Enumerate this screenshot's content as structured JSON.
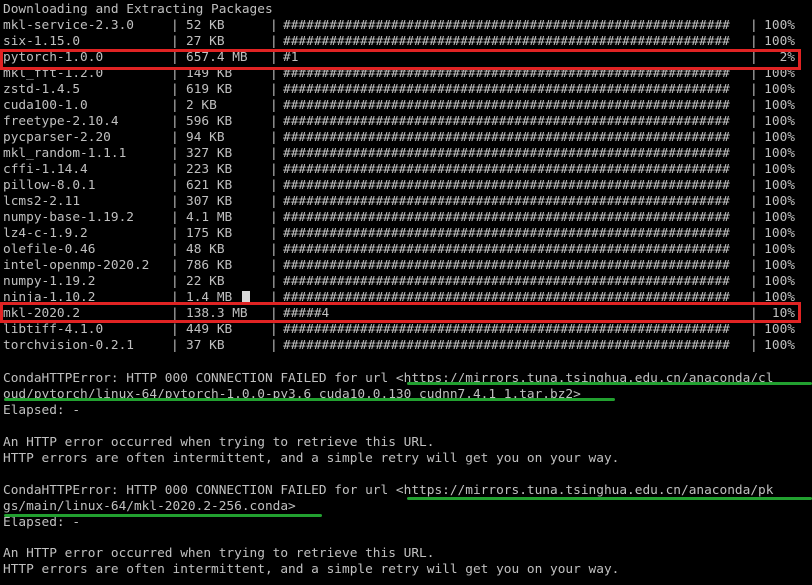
{
  "terminal": {
    "header": "Downloading and Extracting Packages",
    "packages": [
      {
        "name": "mkl-service-2.3.0",
        "size": "52 KB",
        "bar": "##########################################################",
        "percent": "100%"
      },
      {
        "name": "six-1.15.0",
        "size": "27 KB",
        "bar": "##########################################################",
        "percent": "100%"
      },
      {
        "name": "pytorch-1.0.0",
        "size": "657.4 MB",
        "bar": "#1",
        "percent": "2%"
      },
      {
        "name": "mkl_fft-1.2.0",
        "size": "149 KB",
        "bar": "##########################################################",
        "percent": "100%"
      },
      {
        "name": "zstd-1.4.5",
        "size": "619 KB",
        "bar": "##########################################################",
        "percent": "100%"
      },
      {
        "name": "cuda100-1.0",
        "size": "2 KB",
        "bar": "##########################################################",
        "percent": "100%"
      },
      {
        "name": "freetype-2.10.4",
        "size": "596 KB",
        "bar": "##########################################################",
        "percent": "100%"
      },
      {
        "name": "pycparser-2.20",
        "size": "94 KB",
        "bar": "##########################################################",
        "percent": "100%"
      },
      {
        "name": "mkl_random-1.1.1",
        "size": "327 KB",
        "bar": "##########################################################",
        "percent": "100%"
      },
      {
        "name": "cffi-1.14.4",
        "size": "223 KB",
        "bar": "##########################################################",
        "percent": "100%"
      },
      {
        "name": "pillow-8.0.1",
        "size": "621 KB",
        "bar": "##########################################################",
        "percent": "100%"
      },
      {
        "name": "lcms2-2.11",
        "size": "307 KB",
        "bar": "##########################################################",
        "percent": "100%"
      },
      {
        "name": "numpy-base-1.19.2",
        "size": "4.1 MB",
        "bar": "##########################################################",
        "percent": "100%"
      },
      {
        "name": "lz4-c-1.9.2",
        "size": "175 KB",
        "bar": "##########################################################",
        "percent": "100%"
      },
      {
        "name": "olefile-0.46",
        "size": "48 KB",
        "bar": "##########################################################",
        "percent": "100%"
      },
      {
        "name": "intel-openmp-2020.2",
        "size": "786 KB",
        "bar": "##########################################################",
        "percent": "100%"
      },
      {
        "name": "numpy-1.19.2",
        "size": "22 KB",
        "bar": "##########################################################",
        "percent": "100%"
      },
      {
        "name": "ninja-1.10.2",
        "size": "1.4 MB",
        "bar": "##########################################################",
        "percent": "100%"
      },
      {
        "name": "mkl-2020.2",
        "size": "138.3 MB",
        "bar": "#####4",
        "percent": "10%"
      },
      {
        "name": "libtiff-4.1.0",
        "size": "449 KB",
        "bar": "##########################################################",
        "percent": "100%"
      },
      {
        "name": "torchvision-0.2.1",
        "size": "37 KB",
        "bar": "##########################################################",
        "percent": "100%"
      }
    ],
    "errors": [
      {
        "line1": "CondaHTTPError: HTTP 000 CONNECTION FAILED for url <https://mirrors.tuna.tsinghua.edu.cn/anaconda/cl",
        "line2": "oud/pytorch/linux-64/pytorch-1.0.0-py3.6_cuda10.0.130_cudnn7.4.1_1.tar.bz2>",
        "elapsed": "Elapsed: -",
        "msg1": "An HTTP error occurred when trying to retrieve this URL.",
        "msg2": "HTTP errors are often intermittent, and a simple retry will get you on your way."
      },
      {
        "line1": "CondaHTTPError: HTTP 000 CONNECTION FAILED for url <https://mirrors.tuna.tsinghua.edu.cn/anaconda/pk",
        "line2": "gs/main/linux-64/mkl-2020.2-256.conda>",
        "elapsed": "Elapsed: -",
        "msg1": "An HTTP error occurred when trying to retrieve this URL.",
        "msg2": "HTTP errors are often intermittent, and a simple retry will get you on your way."
      }
    ],
    "separator": "|"
  },
  "colors": {
    "background": "#000000",
    "text": "#c0c0c0",
    "highlight": "#e02323",
    "underline": "#22a030"
  }
}
